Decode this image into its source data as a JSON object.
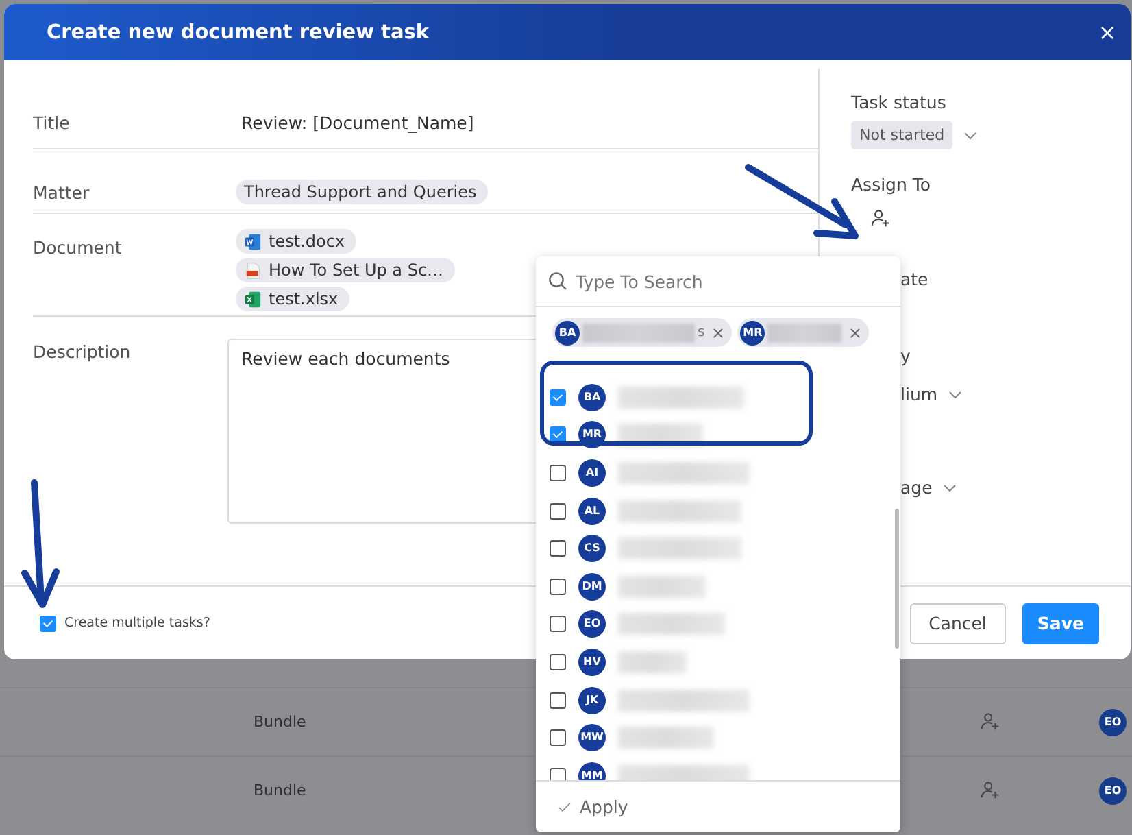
{
  "dialog": {
    "title": "Create new document review task",
    "fields": [
      {
        "kind": "text",
        "label": "Title",
        "value": "Review: [Document_Name]"
      },
      {
        "kind": "chips",
        "label": "Matter",
        "chips": [
          "Thread Support and Queries"
        ]
      },
      {
        "kind": "files",
        "label": "Document",
        "files": [
          {
            "name": "test.docx",
            "kind": "word"
          },
          {
            "name": "How To Set Up a Sc…",
            "kind": "pdf"
          },
          {
            "name": "test.xlsx",
            "kind": "excel"
          }
        ]
      },
      {
        "kind": "textarea",
        "label": "Description",
        "value": "Review each documents"
      }
    ],
    "side": [
      {
        "kind": "select",
        "label": "Task status",
        "value": "Not started"
      },
      {
        "kind": "assign",
        "label": "Assign To"
      },
      {
        "kind": "label",
        "text": "ate"
      },
      {
        "kind": "label",
        "text": "y"
      },
      {
        "kind": "value",
        "text": "lium"
      },
      {
        "kind": "value",
        "text": "age"
      }
    ],
    "multiple_tasks": {
      "label": "Create multiple tasks?",
      "checked": true
    },
    "buttons": [
      {
        "label": "Cancel",
        "kind": "secondary"
      },
      {
        "label": "Save",
        "kind": "primary"
      }
    ]
  },
  "picker": {
    "placeholder": "Type To Search",
    "chips": [
      {
        "initials": "BA",
        "tail": "s"
      },
      {
        "initials": "MR"
      }
    ],
    "options": [
      {
        "initials": "BA",
        "checked": true
      },
      {
        "initials": "MR",
        "checked": true
      },
      {
        "initials": "AI",
        "checked": false
      },
      {
        "initials": "AL",
        "checked": false
      },
      {
        "initials": "CS",
        "checked": false
      },
      {
        "initials": "DM",
        "checked": false
      },
      {
        "initials": "EO",
        "checked": false
      },
      {
        "initials": "HV",
        "checked": false
      },
      {
        "initials": "JK",
        "checked": false
      },
      {
        "initials": "MW",
        "checked": false
      },
      {
        "initials": "MM",
        "checked": false
      }
    ],
    "apply": "Apply"
  },
  "background_rows": [
    {
      "type": "Bundle",
      "initials": "EO"
    },
    {
      "type": "Bundle",
      "initials": "EO"
    }
  ]
}
